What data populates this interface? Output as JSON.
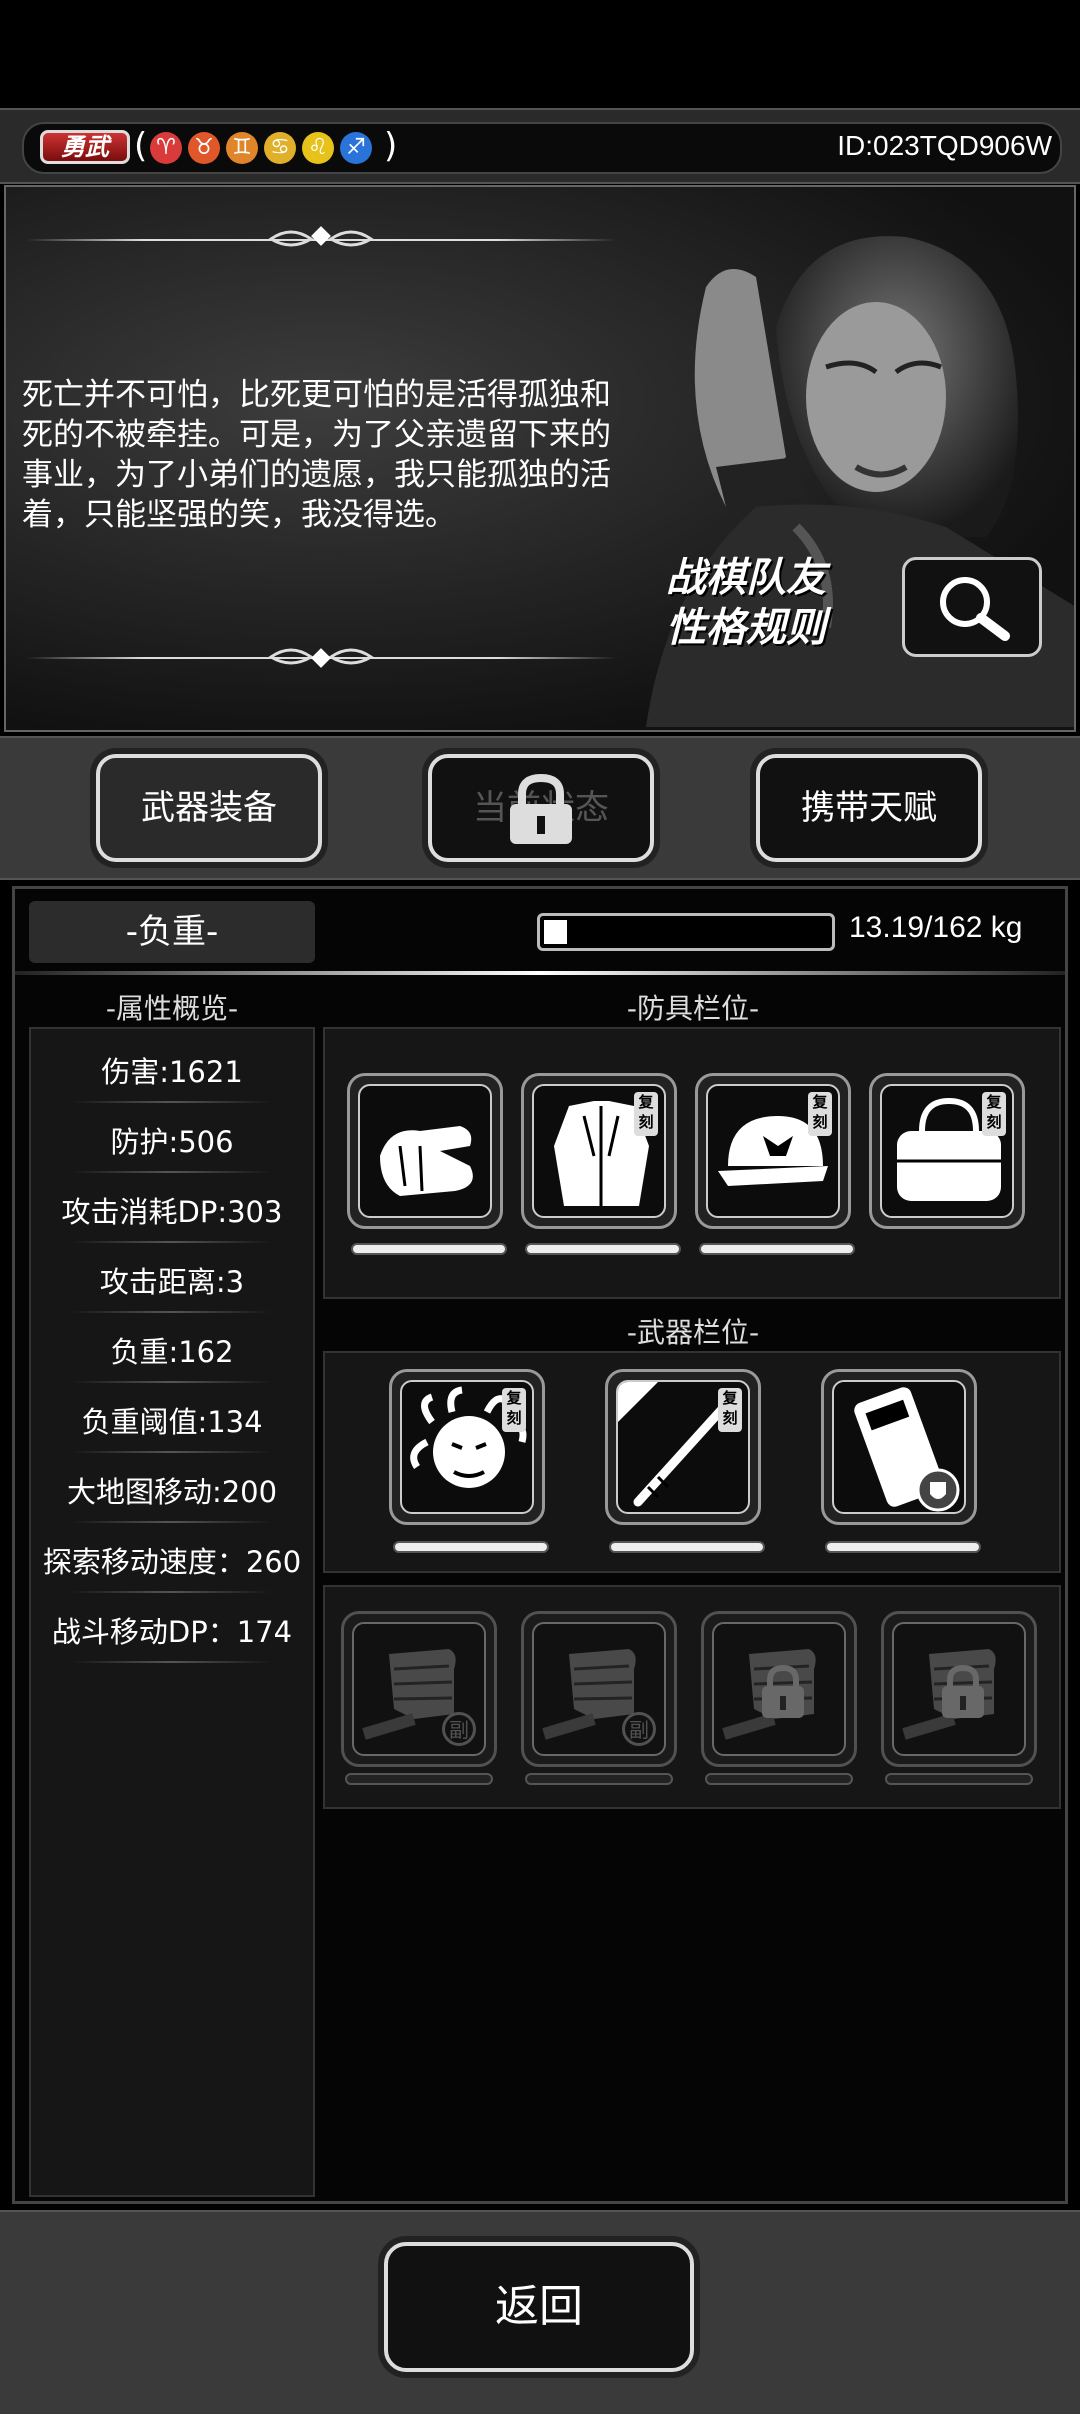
{
  "header": {
    "badge": "勇武",
    "paren_open": "(",
    "paren_close": ")",
    "zodiac": [
      {
        "glyph": "♈",
        "name": "aries-icon",
        "color": "#d93a3a"
      },
      {
        "glyph": "♉",
        "name": "taurus-icon",
        "color": "#e0572a"
      },
      {
        "glyph": "♊",
        "name": "gemini-icon",
        "color": "#e0852a"
      },
      {
        "glyph": "♋",
        "name": "cancer-icon",
        "color": "#e0b02a"
      },
      {
        "glyph": "♌",
        "name": "leo-icon",
        "color": "#e6c21a"
      },
      {
        "glyph": "♐",
        "name": "sagittarius-icon",
        "color": "#2a73d9"
      }
    ],
    "player_id": "ID:023TQD906W"
  },
  "story": {
    "text": "死亡并不可怕，比死更可怕的是活得孤独和死的不被牵挂。可是，为了父亲遗留下来的事业，为了小弟们的遗愿，我只能孤独的活着，只能坚强的笑，我没得选。",
    "rules_line1": "战棋队友",
    "rules_line2": "性格规则"
  },
  "tabs": {
    "weapon": "武器装备",
    "status": "当前状态",
    "talent": "携带天赋"
  },
  "load": {
    "label": "-负重-",
    "value_text": "13.19/162 kg",
    "current": 13.19,
    "max": 162
  },
  "stats": {
    "title": "-属性概览-",
    "items": [
      "伤害:1621",
      "防护:506",
      "攻击消耗DP:303",
      "攻击距离:3",
      "负重:162",
      "负重阈值:134",
      "大地图移动:200",
      "探索移动速度：260",
      "战斗移动DP：174"
    ]
  },
  "armor": {
    "title": "-防具栏位-",
    "tag": "复刻",
    "slots": [
      {
        "icon": "gloves-icon",
        "tagged": false
      },
      {
        "icon": "coat-icon",
        "tagged": true
      },
      {
        "icon": "cap-icon",
        "tagged": true
      },
      {
        "icon": "bag-icon",
        "tagged": true
      }
    ]
  },
  "weapons": {
    "title": "-武器栏位-",
    "tag": "复刻",
    "slots": [
      {
        "icon": "medusa-icon",
        "tagged": true
      },
      {
        "icon": "staff-icon",
        "tagged": true
      },
      {
        "icon": "armor-plate-icon",
        "tagged": false
      }
    ]
  },
  "sub_slots": {
    "sub_label": "副",
    "slots": [
      {
        "icon": "fist-icon",
        "locked": false
      },
      {
        "icon": "fist-icon",
        "locked": false
      },
      {
        "icon": "fist-icon",
        "locked": true
      },
      {
        "icon": "fist-icon",
        "locked": true
      }
    ]
  },
  "footer": {
    "back": "返回"
  }
}
